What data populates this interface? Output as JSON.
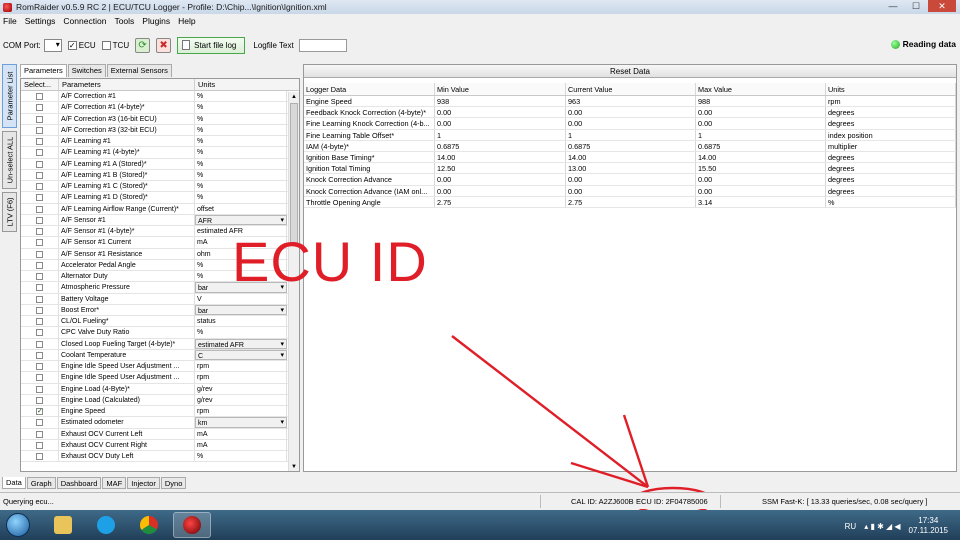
{
  "window": {
    "title": "RomRaider v0.5.9 RC 2 | ECU/TCU Logger - Profile: D:\\Chip...\\Ignition\\Ignition.xml"
  },
  "menu": [
    "File",
    "Settings",
    "Connection",
    "Tools",
    "Plugins",
    "Help"
  ],
  "toolbar": {
    "com_port_label": "COM Port:",
    "com_port_value": "",
    "ecu_label": "ECU",
    "ecu_checked": true,
    "tcu_label": "TCU",
    "tcu_checked": false,
    "start_file_log": "Start file log",
    "logfile_text_label": "Logfile Text",
    "logfile_text_value": "",
    "status": "Reading data"
  },
  "side_tabs": [
    "Parameter List",
    "Un-select ALL",
    "LTV (F6)"
  ],
  "param_tabs": [
    "Parameters",
    "Switches",
    "External Sensors"
  ],
  "param_headers": [
    "Select...",
    "Parameters",
    "Units"
  ],
  "params": [
    {
      "name": "A/F Correction #1",
      "unit": "%",
      "checked": false,
      "dropdown": false
    },
    {
      "name": "A/F Correction #1 (4-byte)*",
      "unit": "%",
      "checked": false,
      "dropdown": false
    },
    {
      "name": "A/F Correction #3 (16-bit ECU)",
      "unit": "%",
      "checked": false,
      "dropdown": false
    },
    {
      "name": "A/F Correction #3 (32-bit ECU)",
      "unit": "%",
      "checked": false,
      "dropdown": false
    },
    {
      "name": "A/F Learning #1",
      "unit": "%",
      "checked": false,
      "dropdown": false
    },
    {
      "name": "A/F Learning #1 (4-byte)*",
      "unit": "%",
      "checked": false,
      "dropdown": false
    },
    {
      "name": "A/F Learning #1 A (Stored)*",
      "unit": "%",
      "checked": false,
      "dropdown": false
    },
    {
      "name": "A/F Learning #1 B (Stored)*",
      "unit": "%",
      "checked": false,
      "dropdown": false
    },
    {
      "name": "A/F Learning #1 C (Stored)*",
      "unit": "%",
      "checked": false,
      "dropdown": false
    },
    {
      "name": "A/F Learning #1 D (Stored)*",
      "unit": "%",
      "checked": false,
      "dropdown": false
    },
    {
      "name": "A/F Learning Airflow Range (Current)*",
      "unit": "offset",
      "checked": false,
      "dropdown": false
    },
    {
      "name": "A/F Sensor #1",
      "unit": "AFR",
      "checked": false,
      "dropdown": true
    },
    {
      "name": "A/F Sensor #1 (4-byte)*",
      "unit": "estimated AFR",
      "checked": false,
      "dropdown": false
    },
    {
      "name": "A/F Sensor #1 Current",
      "unit": "mA",
      "checked": false,
      "dropdown": false
    },
    {
      "name": "A/F Sensor #1 Resistance",
      "unit": "ohm",
      "checked": false,
      "dropdown": false
    },
    {
      "name": "Accelerator Pedal Angle",
      "unit": "%",
      "checked": false,
      "dropdown": false
    },
    {
      "name": "Alternator Duty",
      "unit": "%",
      "checked": false,
      "dropdown": false
    },
    {
      "name": "Atmospheric Pressure",
      "unit": "bar",
      "checked": false,
      "dropdown": true
    },
    {
      "name": "Battery Voltage",
      "unit": "V",
      "checked": false,
      "dropdown": false
    },
    {
      "name": "Boost Error*",
      "unit": "bar",
      "checked": false,
      "dropdown": true
    },
    {
      "name": "CL/OL Fueling*",
      "unit": "status",
      "checked": false,
      "dropdown": false
    },
    {
      "name": "CPC Valve Duty Ratio",
      "unit": "%",
      "checked": false,
      "dropdown": false
    },
    {
      "name": "Closed Loop Fueling Target (4-byte)*",
      "unit": "estimated AFR",
      "checked": false,
      "dropdown": true
    },
    {
      "name": "Coolant Temperature",
      "unit": "C",
      "checked": false,
      "dropdown": true
    },
    {
      "name": "Engine Idle Speed User Adjustment ...",
      "unit": "rpm",
      "checked": false,
      "dropdown": false
    },
    {
      "name": "Engine Idle Speed User Adjustment ...",
      "unit": "rpm",
      "checked": false,
      "dropdown": false
    },
    {
      "name": "Engine Load (4-Byte)*",
      "unit": "g/rev",
      "checked": false,
      "dropdown": false
    },
    {
      "name": "Engine Load (Calculated)",
      "unit": "g/rev",
      "checked": false,
      "dropdown": false
    },
    {
      "name": "Engine Speed",
      "unit": "rpm",
      "checked": true,
      "dropdown": false
    },
    {
      "name": "Estimated odometer",
      "unit": "km",
      "checked": false,
      "dropdown": true
    },
    {
      "name": "Exhaust OCV Current Left",
      "unit": "mA",
      "checked": false,
      "dropdown": false
    },
    {
      "name": "Exhaust OCV Current Right",
      "unit": "mA",
      "checked": false,
      "dropdown": false
    },
    {
      "name": "Exhaust OCV Duty Left",
      "unit": "%",
      "checked": false,
      "dropdown": false
    }
  ],
  "reset_label": "Reset Data",
  "logger_headers": [
    "Logger Data",
    "Min Value",
    "Current Value",
    "Max Value",
    "Units"
  ],
  "logger_rows": [
    [
      "Engine Speed",
      "938",
      "963",
      "988",
      "rpm"
    ],
    [
      "Feedback Knock Correction (4-byte)*",
      "0.00",
      "0.00",
      "0.00",
      "degrees"
    ],
    [
      "Fine Learning Knock Correction (4-b...",
      "0.00",
      "0.00",
      "0.00",
      "degrees"
    ],
    [
      "Fine Learning Table Offset*",
      "1",
      "1",
      "1",
      "index position"
    ],
    [
      "IAM (4-byte)*",
      "0.6875",
      "0.6875",
      "0.6875",
      "multiplier"
    ],
    [
      "Ignition Base Timing*",
      "14.00",
      "14.00",
      "14.00",
      "degrees"
    ],
    [
      "Ignition Total Timing",
      "12.50",
      "13.00",
      "15.50",
      "degrees"
    ],
    [
      "Knock Correction Advance",
      "0.00",
      "0.00",
      "0.00",
      "degrees"
    ],
    [
      "Knock Correction Advance (IAM onl...",
      "0.00",
      "0.00",
      "0.00",
      "degrees"
    ],
    [
      "Throttle Opening Angle",
      "2.75",
      "2.75",
      "3.14",
      "%"
    ]
  ],
  "annotation": {
    "text": "ECU ID",
    "color": "#e01e28"
  },
  "bottom_tabs": [
    "Data",
    "Graph",
    "Dashboard",
    "MAF",
    "Injector",
    "Dyno"
  ],
  "status": {
    "left": "Querying ecu...",
    "cal_id": "CAL ID: A2ZJ600B",
    "ecu_id": "ECU ID: 2F04785006",
    "ssm": "SSM Fast-K: [ 13.33 queries/sec, 0.08 sec/query ]"
  },
  "taskbar": {
    "apps": [
      "explorer-icon",
      "skype-icon",
      "chrome-icon",
      "romraider-icon"
    ],
    "lang": "RU",
    "time": "17:34",
    "date": "07.11.2015"
  }
}
